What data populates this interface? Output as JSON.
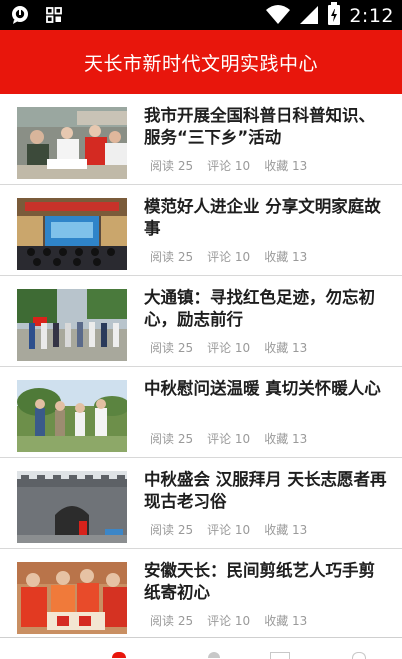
{
  "status_bar": {
    "time": "2:12",
    "left_icons": [
      "chat-bubble-icon",
      "grid-apps-icon"
    ],
    "right_icons": [
      "wifi-icon",
      "signal-icon",
      "battery-icon"
    ]
  },
  "header": {
    "title": "天长市新时代文明实践中心"
  },
  "colors": {
    "brand_red": "#e8160c",
    "title_text": "#1e1e1e",
    "meta_text": "#9a9a9a"
  },
  "articles": [
    {
      "title": "我市开展全国科普日科普知识、服务“三下乡”活动",
      "read": "阅读 25",
      "comment": "评论 10",
      "fav": "收藏 13"
    },
    {
      "title": "模范好人进企业 分享文明家庭故事",
      "read": "阅读 25",
      "comment": "评论 10",
      "fav": "收藏 13"
    },
    {
      "title": "大通镇：寻找红色足迹，勿忘初心，励志前行",
      "read": "阅读 25",
      "comment": "评论 10",
      "fav": "收藏 13"
    },
    {
      "title": "中秋慰问送温暖 真切关怀暖人心",
      "read": "阅读 25",
      "comment": "评论 10",
      "fav": "收藏 13"
    },
    {
      "title": "中秋盛会 汉服拜月 天长志愿者再现古老习俗",
      "read": "阅读 25",
      "comment": "评论 10",
      "fav": "收藏 13"
    },
    {
      "title": "安徽天长：民间剪纸艺人巧手剪纸寄初心",
      "read": "阅读 25",
      "comment": "评论 10",
      "fav": "收藏 13"
    }
  ]
}
